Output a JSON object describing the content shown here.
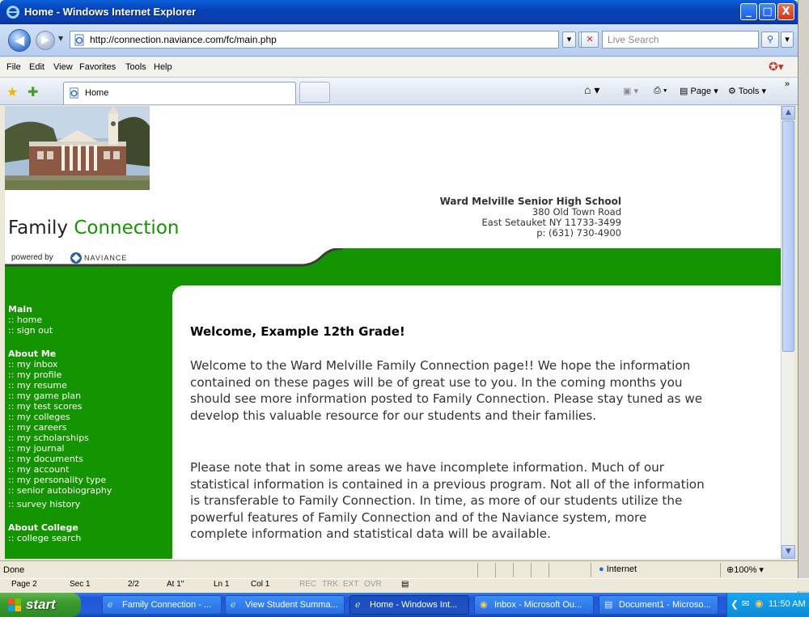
{
  "window": {
    "title": "Home - Windows Internet Explorer",
    "minimize": "_",
    "maximize": "□",
    "close": "X"
  },
  "address": {
    "url": "http://connection.naviance.com/fc/main.php",
    "search_placeholder": "Live Search"
  },
  "menu": [
    "File",
    "Edit",
    "View",
    "Favorites",
    "Tools",
    "Help"
  ],
  "tabs": {
    "active_label": "Home",
    "page_label": "Page",
    "tools_label": "Tools"
  },
  "page": {
    "app_title_part1": "Family ",
    "app_title_part2": "Connection",
    "powered_by": "powered by",
    "naviance": "NAVIANCE",
    "school": {
      "name": "Ward Melville Senior High School",
      "street": "380 Old Town Road",
      "city": "East Setauket NY 11733-3499",
      "phone": "p: (631) 730-4900"
    },
    "sidebar": {
      "main_title": "Main",
      "main_links": [
        ":: home",
        ":: sign out"
      ],
      "about_me_title": "About Me",
      "about_me_links": [
        ":: my inbox",
        ":: my profile",
        ":: my resume",
        ":: my game plan",
        ":: my test scores",
        ":: my colleges",
        ":: my careers",
        ":: my scholarships",
        ":: my journal",
        ":: my documents",
        ":: my account",
        ":: my personality type",
        ":: senior autobiography",
        ":: survey history"
      ],
      "about_college_title": "About College",
      "about_college_links": [
        ":: college search"
      ]
    },
    "welcome_heading": "Welcome, Example 12th Grade!",
    "paragraph1": "Welcome to the Ward Melville Family Connection page!! We hope the information contained on these pages will be of great use to you. In the coming months you should see more information posted to Family Connection. Please stay tuned as we develop this valuable resource for our students and their families.",
    "paragraph2": "Please note that in some areas we have incomplete information. Much of our statistical information is contained in a previous program. Not all of the information is transferable to Family Connection. In time, as more of our students utilize the powerful features of Family Connection and of the Naviance system, more complete information and statistical data will be available."
  },
  "status": {
    "text": "Done",
    "zone": "Internet",
    "zoom": "100%"
  },
  "word_status": {
    "page": "Page 2",
    "sec": "Sec 1",
    "pages": "2/2",
    "at": "At 1\"",
    "ln": "Ln 1",
    "col": "Col 1",
    "rec": "REC",
    "trk": "TRK",
    "ext": "EXT",
    "ovr": "OVR"
  },
  "taskbar": {
    "start": "start",
    "items": [
      "Family Connection - ...",
      "View Student Summa...",
      "Home - Windows Int...",
      "Inbox - Microsoft Ou...",
      "Document1 - Microso..."
    ],
    "clock": "11:50 AM"
  },
  "colors": {
    "green": "#149400",
    "ie_blue": "#0842b8"
  }
}
